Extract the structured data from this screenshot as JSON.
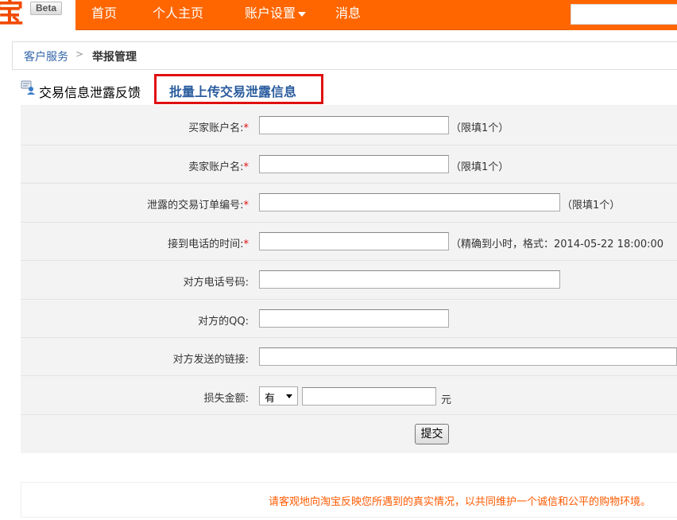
{
  "header": {
    "logo_char": "宝",
    "beta": "Beta",
    "nav": [
      {
        "label": "首页"
      },
      {
        "label": "个人主页"
      },
      {
        "label": "账户设置"
      },
      {
        "label": "消息"
      }
    ]
  },
  "breadcrumb": {
    "link": "客户服务",
    "separator": ">",
    "current": "举报管理"
  },
  "tabs": {
    "active": "交易信息泄露反馈",
    "batch": "批量上传交易泄露信息"
  },
  "form": {
    "required_mark": "*",
    "fields": [
      {
        "label": "买家账户名:",
        "value": "",
        "hint": "（限填1个）"
      },
      {
        "label": "卖家账户名:",
        "value": "",
        "hint": "（限填1个）"
      },
      {
        "label": "泄露的交易订单编号:",
        "value": "",
        "hint": "（限填1个）"
      },
      {
        "label": "接到电话的时间:",
        "value": "",
        "hint": "（精确到小时，格式：2014-05-22 18:00:00"
      },
      {
        "label": "对方电话号码:",
        "value": ""
      },
      {
        "label": "对方的QQ:",
        "value": ""
      },
      {
        "label": "对方发送的链接:",
        "value": ""
      },
      {
        "label": "损失金额:",
        "value": "",
        "select_value": "有",
        "unit": "元"
      }
    ],
    "submit": "提交"
  },
  "notice": "请客观地向淘宝反映您所遇到的真实情况，以共同维护一个诚信和公平的购物环境。",
  "colors": {
    "brand_orange": "#ff6600",
    "link_blue": "#2a5c9e",
    "highlight_red": "#e01010",
    "notice_orange": "#ff5a00"
  }
}
